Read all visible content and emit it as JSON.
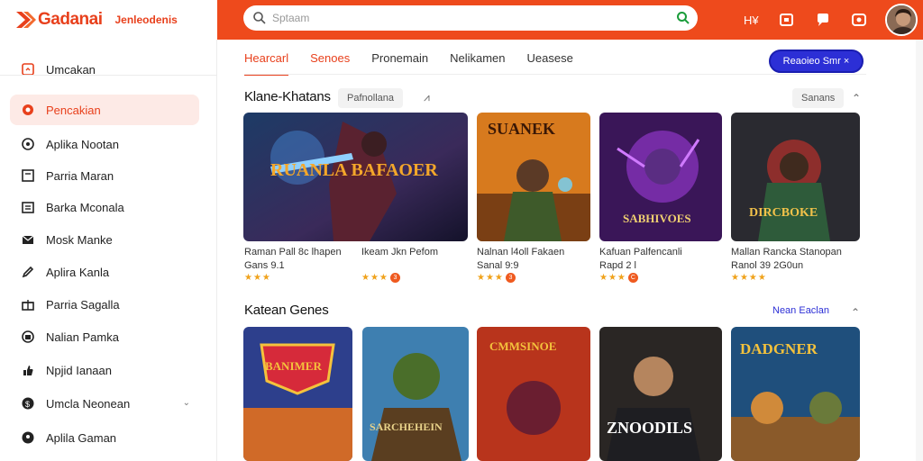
{
  "brand": {
    "name": "Gadanai",
    "tagline": "Jenleodenis",
    "accent": "#ee4a1c"
  },
  "search": {
    "placeholder": "Sptaam"
  },
  "header_icons": [
    "hdr-grid-icon",
    "hdr-tag-icon",
    "hdr-chat-icon",
    "hdr-camera-icon"
  ],
  "sidebar": {
    "items": [
      {
        "label": "Umcakan",
        "icon": "home-icon"
      },
      {
        "label": "Pencakian",
        "icon": "search-icon"
      },
      {
        "label": "Aplika Nootan",
        "icon": "app-icon"
      },
      {
        "label": "Parria Maran",
        "icon": "list-icon"
      },
      {
        "label": "Barka Mconala",
        "icon": "folder-icon"
      },
      {
        "label": "Mosk Manke",
        "icon": "mail-icon"
      },
      {
        "label": "Aplira Kanla",
        "icon": "pen-icon"
      },
      {
        "label": "Parria Sagalla",
        "icon": "gift-icon"
      },
      {
        "label": "Nalian Pamka",
        "icon": "box-icon"
      },
      {
        "label": "Npjid Ianaan",
        "icon": "thumb-icon"
      },
      {
        "label": "Umcla Neonean",
        "icon": "coin-icon"
      },
      {
        "label": "Aplila Gaman",
        "icon": "pin-icon"
      }
    ]
  },
  "tabs": [
    "Hearcarl",
    "Senoes",
    "Pronemain",
    "Nelikamen",
    "Ueasese"
  ],
  "cta": "Reaoieo Smr ×",
  "section1": {
    "title": "Klane-Khatans",
    "chip": "Pafnollana",
    "glyph": "⩘",
    "right_chip": "Sanans",
    "right_glyph": "⌃",
    "cards": [
      {
        "title": "Raman Pall 8c lhapen",
        "sub": "Gans 9.1",
        "stars": "★★★",
        "badge": ""
      },
      {
        "title": "Ikeam Jkn Pefom",
        "sub": "",
        "stars": "★★★",
        "badge": "3"
      },
      {
        "title": "Nalnan l4oll Fakaen",
        "sub": "Sanal 9:9",
        "stars": "★★★",
        "badge": "3"
      },
      {
        "title": "Kafuan Palfencanli",
        "sub": "Rapd 2 l",
        "stars": "★★★",
        "badge": "C"
      },
      {
        "title": "Mallan Rancka Stanopan",
        "sub": "Ranol 39 2G0un",
        "stars": "★★★★",
        "badge": ""
      }
    ],
    "art_text": [
      "RUANLA BAFAOER",
      "SUANEK",
      "SABHIVOES",
      "DIRCBOKE"
    ]
  },
  "section2": {
    "title": "Katean Genes",
    "link": "Nean Eaclan",
    "glyph": "⌃",
    "art_text": [
      "BANIMER",
      "SARCHEHEIN",
      "CMMSINOE",
      "ZNOODILS",
      "DADGNER"
    ]
  }
}
